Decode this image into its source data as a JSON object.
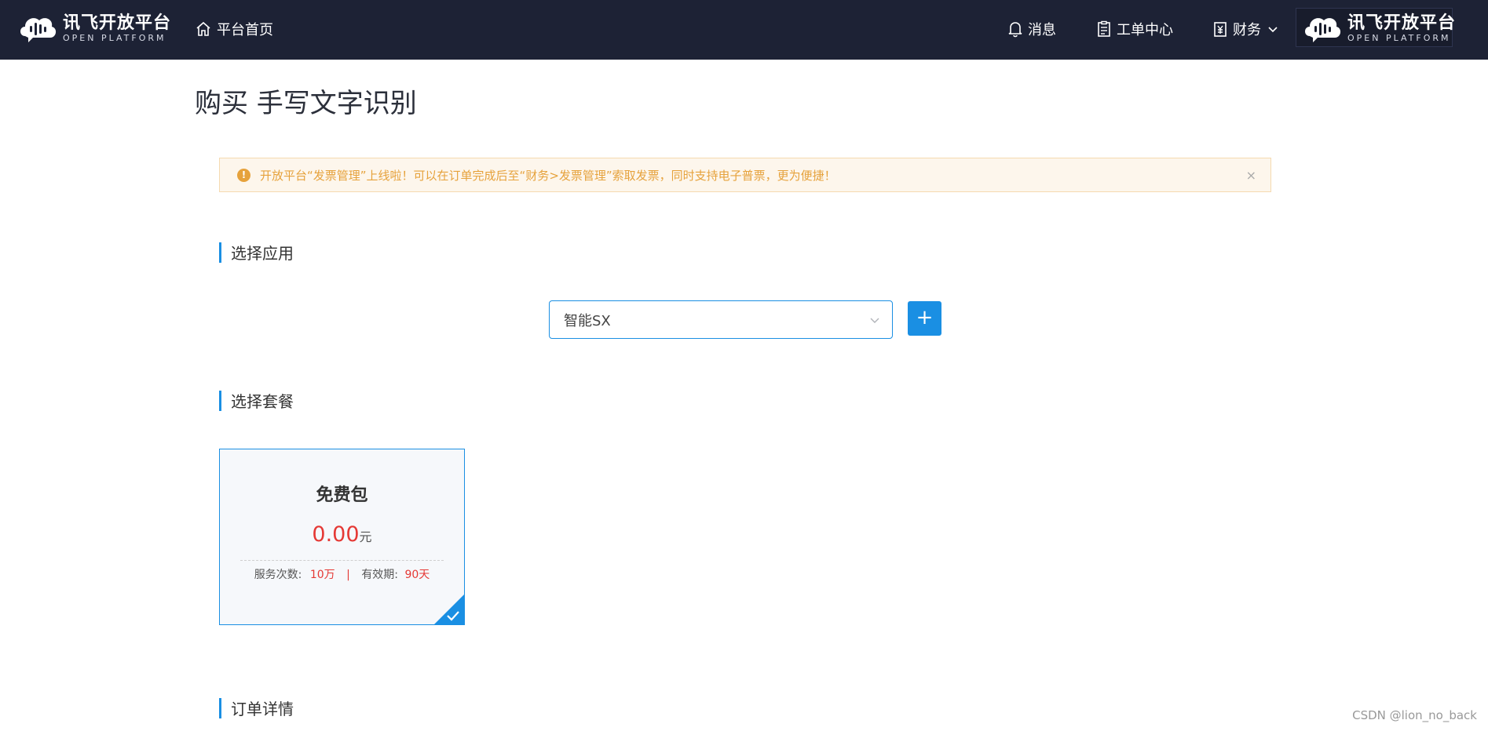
{
  "header": {
    "logo_cn": "讯飞开放平台",
    "logo_en": "OPEN PLATFORM",
    "home_label": "平台首页",
    "messages_label": "消息",
    "ticket_label": "工单中心",
    "finance_label": "财务"
  },
  "page": {
    "title": "购买 手写文字识别"
  },
  "alert": {
    "text": "开放平台“发票管理”上线啦！可以在订单完成后至“财务>发票管理”索取发票，同时支持电子普票，更为便捷！",
    "close_glyph": "×"
  },
  "sections": {
    "select_app": "选择应用",
    "select_package": "选择套餐",
    "order_details": "订单详情"
  },
  "app_select": {
    "value": "智能SX",
    "add_glyph": "+"
  },
  "package": {
    "name": "免费包",
    "price": "0.00",
    "unit": "元",
    "service_label": "服务次数:",
    "service_value": "10万",
    "separator": "|",
    "validity_label": "有效期:",
    "validity_value": "90天"
  },
  "watermark": "CSDN @lion_no_back",
  "colors": {
    "header_bg": "#1d2235",
    "accent": "#1a8fe3",
    "warning": "#e6a23c",
    "price_red": "#e53935"
  },
  "icons": [
    "cloud-logo-icon",
    "home-icon",
    "bell-icon",
    "clipboard-icon",
    "finance-icon",
    "chevron-down-icon",
    "warning-icon",
    "close-icon",
    "check-icon"
  ]
}
